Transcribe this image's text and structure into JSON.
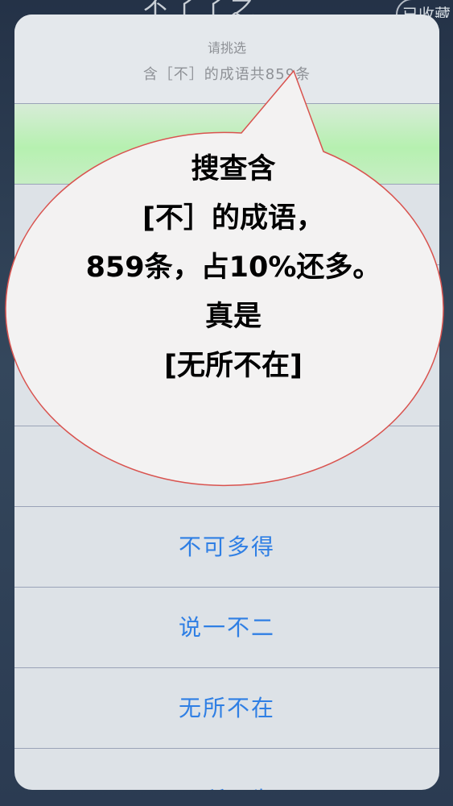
{
  "background": {
    "title": "不了了之",
    "favorite_label": "已收藏"
  },
  "sheet": {
    "title": "请挑选",
    "subtitle": "含［不］的成语共859条",
    "rows": [
      {
        "label": ""
      },
      {
        "label": ""
      },
      {
        "label": ""
      },
      {
        "label": ""
      },
      {
        "label": ""
      },
      {
        "label": "不可多得"
      },
      {
        "label": "说一不二"
      },
      {
        "label": "无所不在"
      },
      {
        "label": "无所不为"
      }
    ]
  },
  "annotation": {
    "lines": [
      "搜查含",
      "[不］的成语，",
      "859条，占10%还多。",
      "真是",
      "[无所不在]"
    ]
  },
  "colors": {
    "link_blue": "#2f7fe4",
    "highlight_green": "#b6f0b0",
    "bubble_border": "#d9534f"
  }
}
